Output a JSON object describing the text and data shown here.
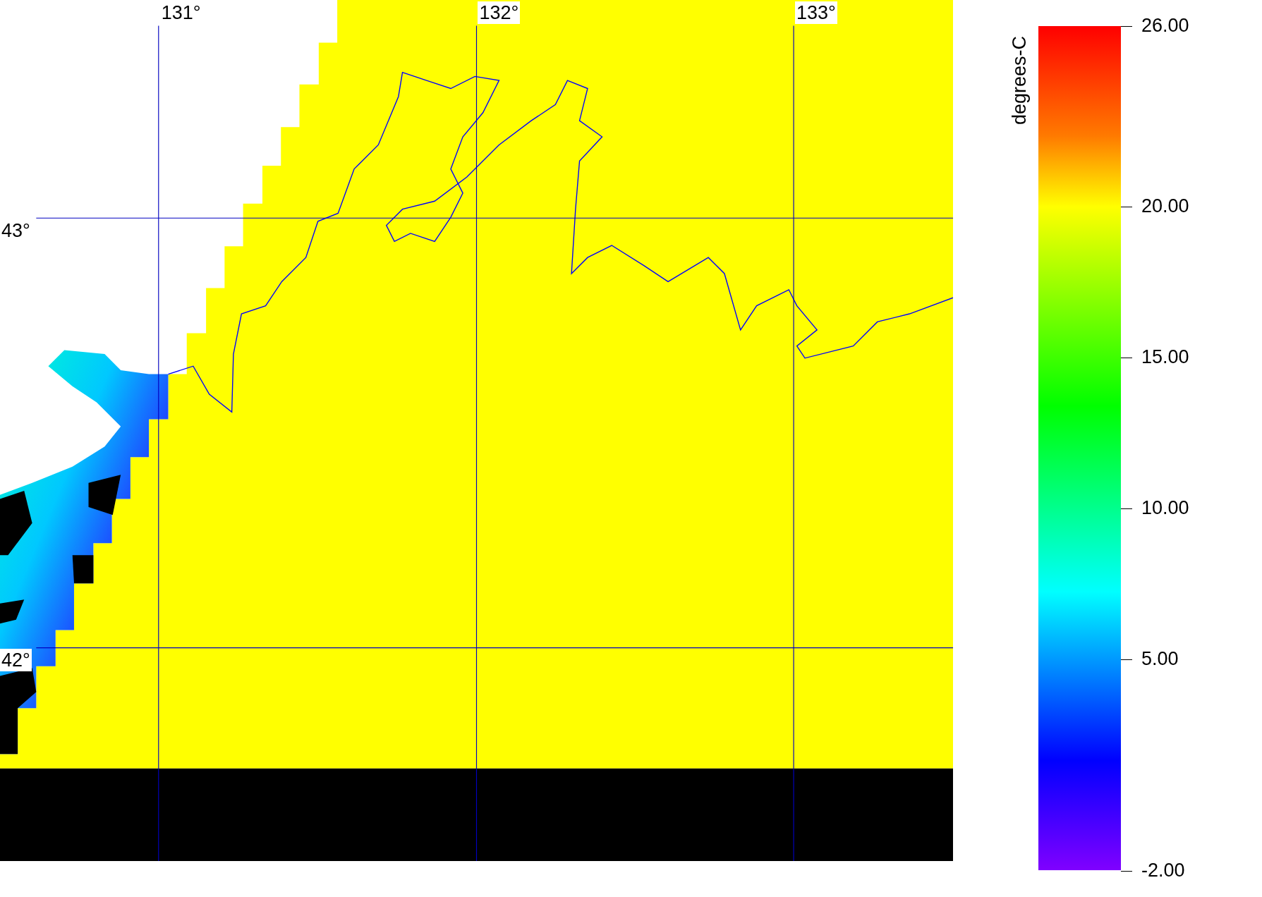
{
  "map": {
    "lon_labels": [
      "131°",
      "132°",
      "133°"
    ],
    "lat_labels": [
      "43°",
      "42°"
    ]
  },
  "colorbar": {
    "unit": "degrees-C",
    "ticks": [
      "26.00",
      "20.00",
      "15.00",
      "10.00",
      "5.00",
      "-2.00"
    ]
  }
}
